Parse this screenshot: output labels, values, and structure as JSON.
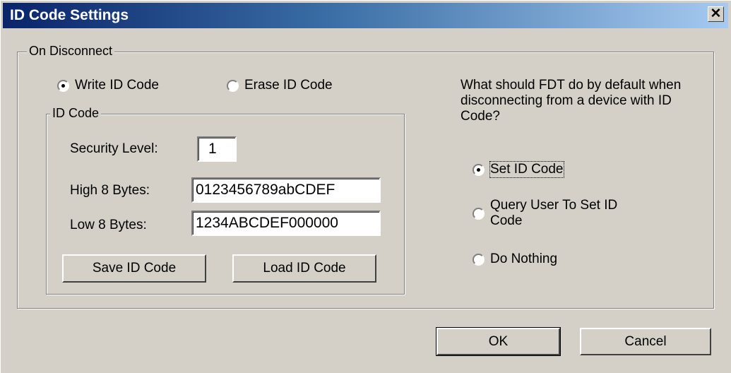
{
  "window": {
    "title": "ID Code Settings",
    "close_glyph": "✕"
  },
  "on_disconnect": {
    "legend": "On Disconnect",
    "write_label": "Write ID Code",
    "erase_label": "Erase ID Code",
    "selected": "write"
  },
  "id_code": {
    "legend": "ID Code",
    "security_label": "Security Level:",
    "security_value": "1",
    "high_label": "High 8 Bytes:",
    "high_value": "0123456789abCDEF",
    "low_label": "Low 8 Bytes:",
    "low_value": "1234ABCDEF000000",
    "save_label": "Save ID Code",
    "load_label": "Load ID Code"
  },
  "default_action": {
    "question": "What should FDT do by default when disconnecting from a device with ID Code?",
    "options": [
      "Set ID Code",
      "Query User To Set ID Code",
      "Do Nothing"
    ],
    "selected": "Set ID Code"
  },
  "footer": {
    "ok_label": "OK",
    "cancel_label": "Cancel"
  }
}
